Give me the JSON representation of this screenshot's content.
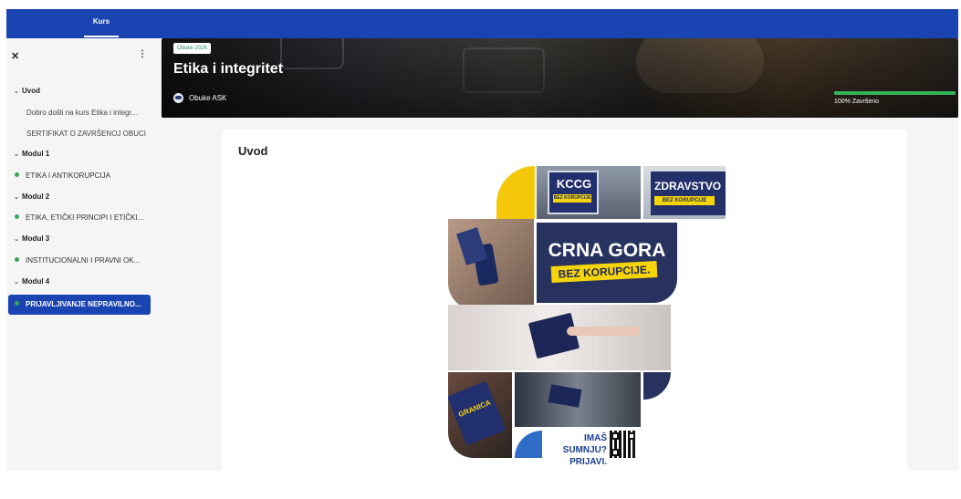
{
  "topbar": {
    "tab_label": "Kurs"
  },
  "sidebar": {
    "close_icon": "close-icon",
    "more_icon": "more-vertical-icon",
    "items": [
      {
        "kind": "section",
        "label": "Uvod"
      },
      {
        "kind": "sub",
        "label": "Dobro došli na kurs Etika i integr..."
      },
      {
        "kind": "sub",
        "label": "SERTIFIKAT O ZAVRŠENOJ OBUCI"
      },
      {
        "kind": "section",
        "label": "Modul 1"
      },
      {
        "kind": "lesson",
        "label": "ETIKA I ANTIKORUPCIJA"
      },
      {
        "kind": "section",
        "label": "Modul 2"
      },
      {
        "kind": "lesson",
        "label": "ETIKA, ETIČKI PRINCIPI I ETIČKI..."
      },
      {
        "kind": "section",
        "label": "Modul 3"
      },
      {
        "kind": "lesson",
        "label": "INSTITUCIONALNI I PRAVNI OK..."
      },
      {
        "kind": "section",
        "label": "Modul 4"
      },
      {
        "kind": "lesson",
        "label": "PRIJAVLJIVANJE NEPRAVILNO...",
        "active": true
      }
    ]
  },
  "hero": {
    "badge": "Obuke 2026",
    "title": "Etika i integritet",
    "author": "Obuke ASK",
    "progress_fraction": 1.0,
    "progress_text": "100% Završeno"
  },
  "content": {
    "heading": "Uvod",
    "poster": {
      "kccg": "KCCG",
      "kccg_tag": "BEZ KORUPCIJE",
      "zdravstvo": "ZDRAVSTVO",
      "zdravstvo_tag": "BEZ KORUPCIJE",
      "main_line1": "CRNA GORA",
      "main_line2": "BEZ KORUPCIJE.",
      "granica": "GRANICA",
      "cta_line1": "IMAŠ SUMNJU?",
      "cta_line2": "PRIJAVI."
    }
  },
  "colors": {
    "brand_blue": "#1b44b3",
    "poster_navy": "#27325e",
    "poster_yellow": "#f5d40a",
    "done_green": "#34b35a"
  }
}
